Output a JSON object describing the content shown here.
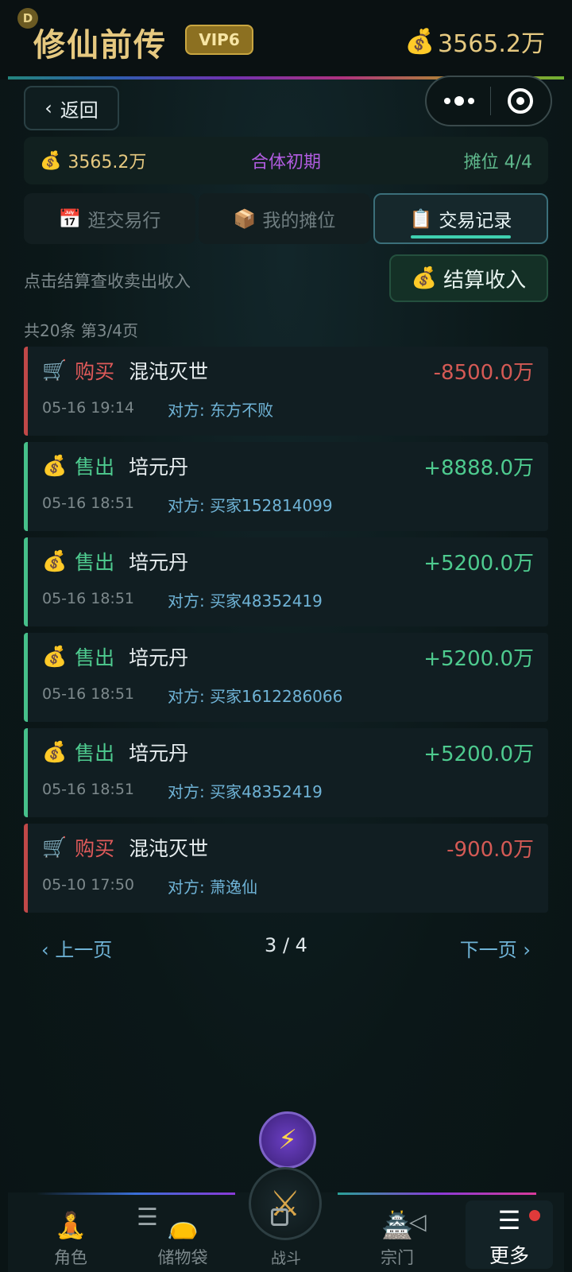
{
  "header": {
    "badge_letter": "D",
    "title": "修仙前传",
    "vip": "VIP6",
    "coins": "3565.2万"
  },
  "nav": {
    "back_label": "返回"
  },
  "info": {
    "balance": "3565.2万",
    "realm": "合体初期",
    "stall": "摊位 4/4"
  },
  "tabs": [
    {
      "label": "逛交易行",
      "icon": "calendar-icon"
    },
    {
      "label": "我的摊位",
      "icon": "package-icon"
    },
    {
      "label": "交易记录",
      "icon": "clipboard-icon"
    }
  ],
  "hint": "点击结算查收卖出收入",
  "settle_label": "结算收入",
  "count_text": "共20条  第3/4页",
  "records": [
    {
      "type": "购买",
      "item": "混沌灭世",
      "amount": "-8500.0万",
      "time": "05-16 19:14",
      "party": "对方: 东方不败"
    },
    {
      "type": "售出",
      "item": "培元丹",
      "amount": "+8888.0万",
      "time": "05-16 18:51",
      "party": "对方: 买家152814099"
    },
    {
      "type": "售出",
      "item": "培元丹",
      "amount": "+5200.0万",
      "time": "05-16 18:51",
      "party": "对方: 买家48352419"
    },
    {
      "type": "售出",
      "item": "培元丹",
      "amount": "+5200.0万",
      "time": "05-16 18:51",
      "party": "对方: 买家1612286066"
    },
    {
      "type": "售出",
      "item": "培元丹",
      "amount": "+5200.0万",
      "time": "05-16 18:51",
      "party": "对方: 买家48352419"
    },
    {
      "type": "购买",
      "item": "混沌灭世",
      "amount": "-900.0万",
      "time": "05-10 17:50",
      "party": "对方: 萧逸仙"
    }
  ],
  "pager": {
    "prev": "上一页",
    "page": "3 / 4",
    "next": "下一页"
  },
  "bottom_nav": {
    "character": "角色",
    "storage": "储物袋",
    "battle": "战斗",
    "sect": "宗门",
    "more": "更多"
  },
  "colors": {
    "buy": "#e05a5a",
    "sell": "#4ecb8f",
    "accent": "#3fd0b0",
    "gold": "#e6c980"
  }
}
